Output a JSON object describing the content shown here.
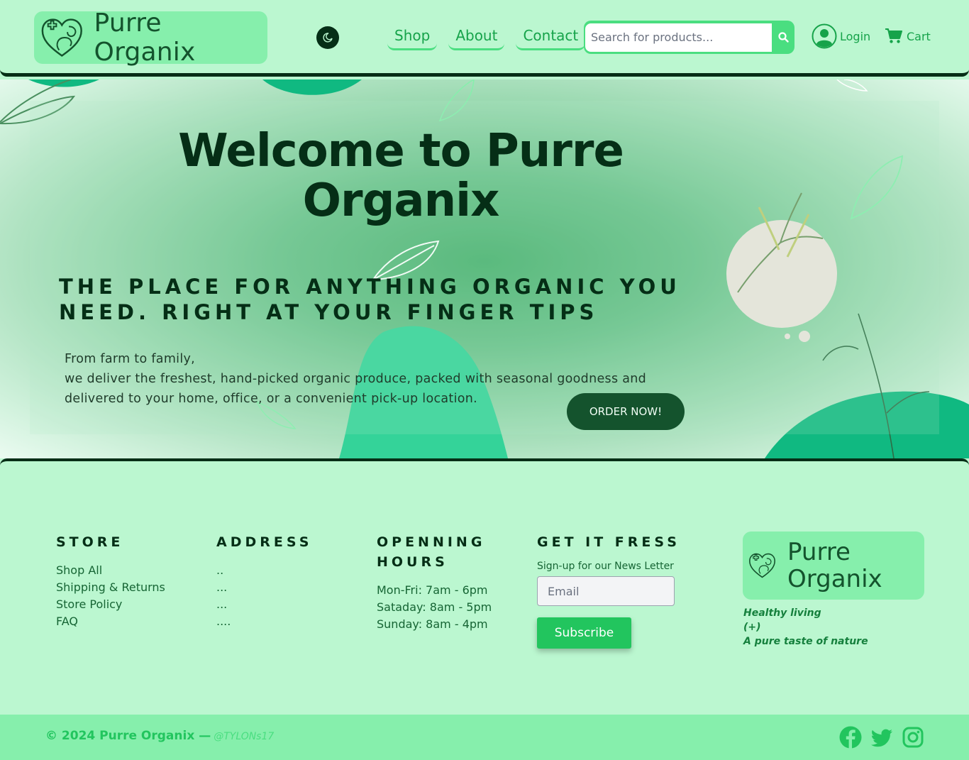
{
  "header": {
    "brand_name": "Purre Organix",
    "nav": [
      "Shop",
      "About",
      "Contact"
    ],
    "search_placeholder": "Search for products...",
    "login_label": "Login",
    "cart_label": "Cart"
  },
  "hero": {
    "title": "Welcome to Purre Organix",
    "tagline": "THE PLACE FOR ANYTHING ORGANIC YOU NEED. RIGHT AT YOUR FINGER TIPS",
    "desc_line1": "From farm to family,",
    "desc_line2": "we deliver the freshest, hand-picked organic produce, packed with seasonal goodness and delivered to your home, office, or a convenient pick-up location.",
    "cta_label": "ORDER NOW!"
  },
  "footer": {
    "store": {
      "heading": "STORE",
      "links": [
        "Shop All",
        "Shipping & Returns",
        "Store Policy",
        "FAQ"
      ]
    },
    "address": {
      "heading": "ADDRESS",
      "lines": [
        "..",
        "...",
        "...",
        "...."
      ]
    },
    "hours": {
      "heading": "OPENNING HOURS",
      "lines": [
        "Mon-Fri: 7am - 6pm",
        "Sataday: 8am - 5pm",
        "Sunday: 8am - 4pm"
      ]
    },
    "newsletter": {
      "heading": "GET IT FRESS",
      "label": "Sign-up for our News Letter",
      "email_placeholder": "Email",
      "button": "Subscribe"
    },
    "brand_name": "Purre Organix",
    "motto": [
      "Healthy living",
      "(+)",
      "A pure taste of nature"
    ]
  },
  "bottom": {
    "copyright": "© 2024 Purre Organix —",
    "handle": "@TYLONs17"
  },
  "icons": [
    "heart-leaf-logo-icon",
    "moon-icon",
    "search-icon",
    "user-icon",
    "cart-icon",
    "facebook-icon",
    "twitter-icon",
    "instagram-icon"
  ],
  "colors": {
    "mint": "#bbf7d0",
    "green_light": "#86efac",
    "green": "#22c55e",
    "dark_green": "#052e16",
    "text_green": "#16a34a"
  }
}
